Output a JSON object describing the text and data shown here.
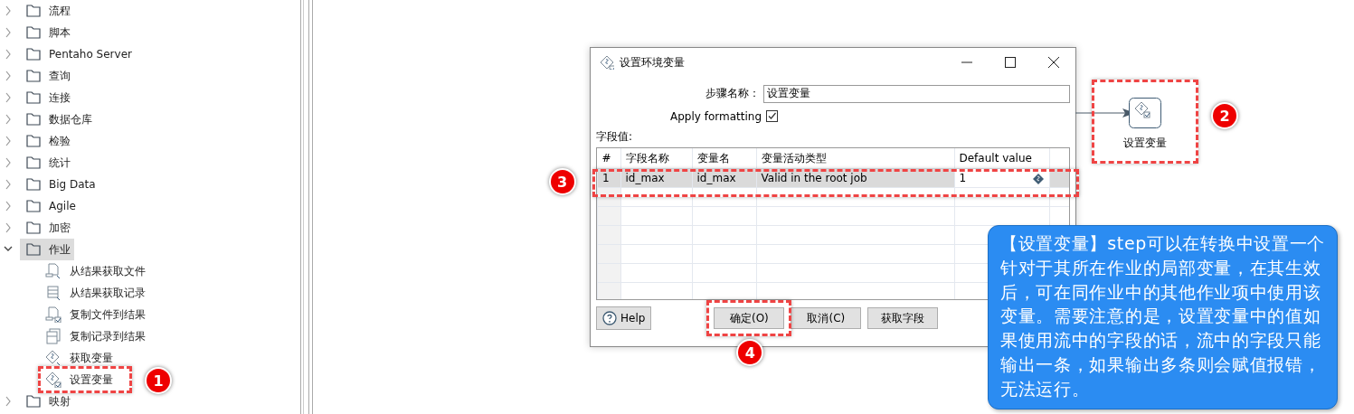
{
  "tree": {
    "items": [
      {
        "label": "流程",
        "expanded": false,
        "selected": false
      },
      {
        "label": "脚本",
        "expanded": false,
        "selected": false
      },
      {
        "label": "Pentaho Server",
        "expanded": false,
        "selected": false
      },
      {
        "label": "查询",
        "expanded": false,
        "selected": false
      },
      {
        "label": "连接",
        "expanded": false,
        "selected": false
      },
      {
        "label": "数据仓库",
        "expanded": false,
        "selected": false
      },
      {
        "label": "检验",
        "expanded": false,
        "selected": false
      },
      {
        "label": "统计",
        "expanded": false,
        "selected": false
      },
      {
        "label": "Big Data",
        "expanded": false,
        "selected": false
      },
      {
        "label": "Agile",
        "expanded": false,
        "selected": false
      },
      {
        "label": "加密",
        "expanded": false,
        "selected": false
      },
      {
        "label": "作业",
        "expanded": true,
        "selected": true,
        "children": [
          {
            "label": "从结果获取文件",
            "kind": "file"
          },
          {
            "label": "从结果获取记录",
            "kind": "record"
          },
          {
            "label": "复制文件到结果",
            "kind": "file-check"
          },
          {
            "label": "复制记录到结果",
            "kind": "stack"
          },
          {
            "label": "获取变量",
            "kind": "diamond"
          },
          {
            "label": "设置变量",
            "kind": "diamond-check",
            "badge": "1"
          }
        ]
      },
      {
        "label": "映射",
        "expanded": false,
        "selected": false
      }
    ]
  },
  "dialog": {
    "title": "设置环境变量",
    "step_name_label": "步骤名称：",
    "step_name_value": "设置变量",
    "apply_formatting_label": "Apply formatting",
    "apply_formatting_checked": true,
    "fields_label": "字段值:",
    "table": {
      "columns": [
        "#",
        "字段名称",
        "变量名",
        "变量活动类型",
        "Default value"
      ],
      "rows": [
        {
          "cells": [
            "1",
            "id_max",
            "id_max",
            "Valid in the root job",
            "1"
          ],
          "selected": true,
          "badge": "3"
        }
      ]
    },
    "help": "Help",
    "buttons": [
      {
        "label": "确定(O)",
        "badge": "4"
      },
      {
        "label": "取消(C)"
      },
      {
        "label": "获取字段"
      }
    ]
  },
  "node": {
    "label": "设置变量",
    "badge": "2"
  },
  "callout": {
    "text": "【设置变量】step可以在转换中设置一个针对于其所在作业的局部变量，在其生效后，可在同作业中的其他作业项中使用该变量。需要注意的是，设置变量中的值如果使用流中的字段的话，流中的字段只能输出一条，如果输出多条则会赋值报错，无法运行。"
  }
}
